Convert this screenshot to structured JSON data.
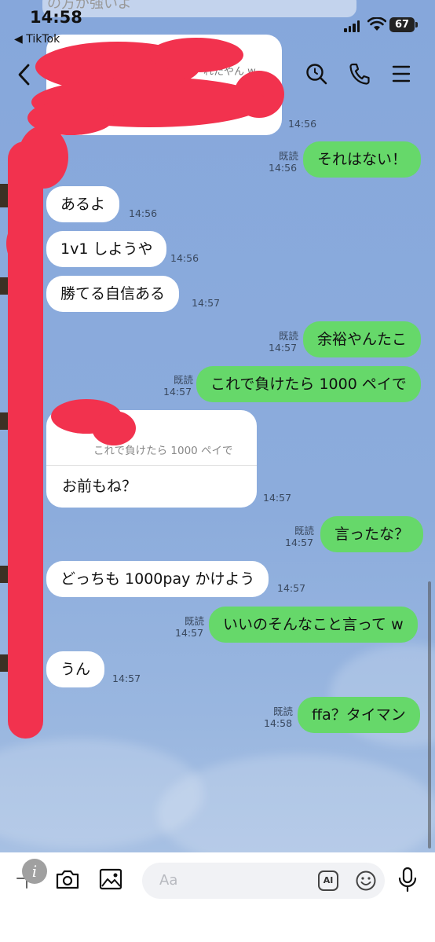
{
  "status_bar": {
    "time": "14:58",
    "back_app": "◀ TikTok",
    "battery": "67"
  },
  "previous": {
    "visible_text": "の方が強いよ",
    "quote_text": "れたやん w",
    "time": "14:56"
  },
  "messages": [
    {
      "text": "それはない！",
      "read": "既読",
      "time": "14:56"
    },
    {
      "text": "あるよ",
      "time": "14:56"
    },
    {
      "text": "1v1 しようや",
      "time": "14:56"
    },
    {
      "text": "勝てる自信ある",
      "time": "14:57"
    },
    {
      "text": "余裕やんたこ",
      "read": "既読",
      "time": "14:57"
    },
    {
      "text": "これで負けたら 1000 ペイで",
      "read": "既読",
      "time": "14:57"
    },
    {
      "quote": "これで負けたら 1000 ペイで",
      "text": "お前もね？",
      "time": "14:57"
    },
    {
      "text": "言ったな？",
      "read": "既読",
      "time": "14:57"
    },
    {
      "text": "どっちも 1000pay かけよう",
      "time": "14:57"
    },
    {
      "text": "いいのそんなこと言って w",
      "read": "既読",
      "time": "14:57"
    },
    {
      "text": "うん",
      "time": "14:57"
    },
    {
      "text": "ffa？タイマン",
      "read": "既読",
      "time": "14:58"
    }
  ],
  "input": {
    "placeholder": "Aa",
    "ai_label": "AI"
  },
  "colors": {
    "outgoing": "#66d86a",
    "incoming": "#ffffff",
    "background": "#8aaad8",
    "scribble": "#f2324e"
  }
}
